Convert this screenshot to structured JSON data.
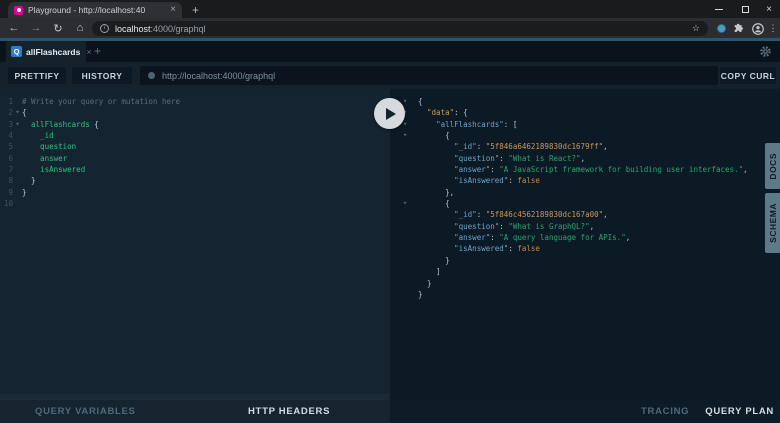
{
  "browser": {
    "tab_title": "Playground - http://localhost:40",
    "tab_close": "×",
    "new_tab": "+",
    "url": {
      "host": "localhost",
      "rest": ":4000/graphql"
    },
    "icons": {
      "back": "←",
      "forward": "→",
      "reload": "↻",
      "home": "⌂",
      "star": "☆",
      "menu": "⋮",
      "info": "i",
      "close": "×"
    }
  },
  "playground": {
    "session_tab": {
      "badge": "Q",
      "label": "allFlashcards",
      "close": "×"
    },
    "new_tab": "+",
    "toolbar": {
      "prettify": "PRETTIFY",
      "history": "HISTORY",
      "endpoint": "http://localhost:4000/graphql",
      "copy_curl": "COPY CURL"
    },
    "fold_glyph": "▾",
    "editor": {
      "line_count": 10,
      "folds": [
        2,
        3
      ],
      "lines": [
        [
          [
            "cm",
            "# Write your query or mutation here"
          ]
        ],
        [
          [
            "pu",
            "{"
          ]
        ],
        [
          [
            "pu",
            "  "
          ],
          [
            "fd",
            "allFlashcards"
          ],
          [
            "pu",
            " {"
          ]
        ],
        [
          [
            "fd",
            "    _id"
          ]
        ],
        [
          [
            "fd",
            "    question"
          ]
        ],
        [
          [
            "fd",
            "    answer"
          ]
        ],
        [
          [
            "fd",
            "    isAnswered"
          ]
        ],
        [
          [
            "pu",
            "  }"
          ]
        ],
        [
          [
            "pu",
            "}"
          ]
        ],
        []
      ]
    },
    "response": {
      "folds": [
        1,
        2,
        3,
        4,
        10
      ],
      "lines": [
        [
          [
            "pu",
            "{"
          ]
        ],
        [
          [
            "pu",
            "  "
          ],
          [
            "am",
            "\"data\""
          ],
          [
            "pu",
            ": {"
          ]
        ],
        [
          [
            "pu",
            "    "
          ],
          [
            "ky",
            "\"allFlashcards\""
          ],
          [
            "pu",
            ": ["
          ]
        ],
        [
          [
            "pu",
            "      {"
          ]
        ],
        [
          [
            "pu",
            "        "
          ],
          [
            "ky",
            "\"_id\""
          ],
          [
            "pu",
            ": "
          ],
          [
            "am",
            "\"5f846a6462189830dc1679ff\""
          ],
          [
            "pu",
            ","
          ]
        ],
        [
          [
            "pu",
            "        "
          ],
          [
            "ky",
            "\"question\""
          ],
          [
            "pu",
            ": "
          ],
          [
            "st",
            "\"What is React?\""
          ],
          [
            "pu",
            ","
          ]
        ],
        [
          [
            "pu",
            "        "
          ],
          [
            "ky",
            "\"answer\""
          ],
          [
            "pu",
            ": "
          ],
          [
            "st",
            "\"A JavaScript framework for building user interfaces.\""
          ],
          [
            "pu",
            ","
          ]
        ],
        [
          [
            "pu",
            "        "
          ],
          [
            "ky",
            "\"isAnswered\""
          ],
          [
            "pu",
            ": "
          ],
          [
            "bo",
            "false"
          ]
        ],
        [
          [
            "pu",
            "      },"
          ]
        ],
        [
          [
            "pu",
            "      {"
          ]
        ],
        [
          [
            "pu",
            "        "
          ],
          [
            "ky",
            "\"_id\""
          ],
          [
            "pu",
            ": "
          ],
          [
            "am",
            "\"5f846c4562189830dc167a00\""
          ],
          [
            "pu",
            ","
          ]
        ],
        [
          [
            "pu",
            "        "
          ],
          [
            "ky",
            "\"question\""
          ],
          [
            "pu",
            ": "
          ],
          [
            "st",
            "\"What is GraphQL?\""
          ],
          [
            "pu",
            ","
          ]
        ],
        [
          [
            "pu",
            "        "
          ],
          [
            "ky",
            "\"answer\""
          ],
          [
            "pu",
            ": "
          ],
          [
            "st",
            "\"A query language for APIs.\""
          ],
          [
            "pu",
            ","
          ]
        ],
        [
          [
            "pu",
            "        "
          ],
          [
            "ky",
            "\"isAnswered\""
          ],
          [
            "pu",
            ": "
          ],
          [
            "bo",
            "false"
          ]
        ],
        [
          [
            "pu",
            "      }"
          ]
        ],
        [
          [
            "pu",
            "    ]"
          ]
        ],
        [
          [
            "pu",
            "  }"
          ]
        ],
        [
          [
            "pu",
            "}"
          ]
        ]
      ]
    },
    "side_tabs": {
      "docs": "DOCS",
      "schema": "SCHEMA"
    },
    "footer_left": {
      "query_variables": "QUERY VARIABLES",
      "http_headers": "HTTP HEADERS"
    },
    "footer_right": {
      "tracing": "TRACING",
      "query_plan": "QUERY PLAN"
    },
    "colors": {
      "favicon_pink": "#e10098",
      "badge_blue": "#2d7bd1",
      "field_green": "#2ec27e",
      "string_green": "#2fa36d",
      "key_blue": "#6fa3c7",
      "amber": "#c9995a",
      "bool_orange": "#cc8640",
      "side_tab": "#5e7a88",
      "play_circle": "#d6dade",
      "editor_bg": "#152431",
      "response_bg": "#0c1a26",
      "chrome_bar": "#2b2d30"
    }
  }
}
